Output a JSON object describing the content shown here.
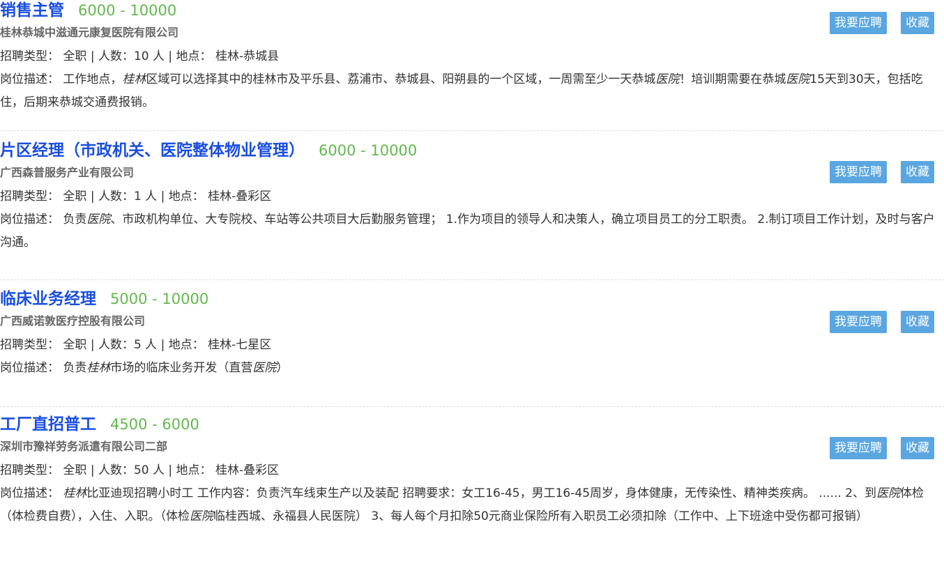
{
  "labels": {
    "type_prefix": "招聘类型：",
    "count_prefix": "人数：",
    "location_prefix": "地点：",
    "desc_prefix": "岗位描述：",
    "sep": "|"
  },
  "jobs": [
    {
      "title": "销售主管",
      "salary": "6000 - 10000",
      "company": "桂林恭城中滋通元康复医院有限公司",
      "type": "全职",
      "count": "10 人",
      "location": "桂林-恭城县",
      "apply_label": "我要应聘",
      "save_label": "收藏",
      "desc_parts": [
        {
          "t": "工作地点，",
          "em": false
        },
        {
          "t": "桂林",
          "em": true
        },
        {
          "t": "区域可以选择其中的桂林市及平乐县、荔浦市、恭城县、阳朔县的一个区域，一周需至少一天恭城",
          "em": false
        },
        {
          "t": "医院",
          "em": true
        },
        {
          "t": "！培训期需要在恭城",
          "em": false
        },
        {
          "t": "医院",
          "em": true
        },
        {
          "t": "15天到30天，包括吃住，后期来恭城交通费报销。",
          "em": false
        }
      ]
    },
    {
      "title": "片区经理（市政机关、医院整体物业管理）",
      "salary": "6000 - 10000",
      "company": "广西森普服务产业有限公司",
      "type": "全职",
      "count": "1 人",
      "location": "桂林-叠彩区",
      "apply_label": "我要应聘",
      "save_label": "收藏",
      "desc_parts": [
        {
          "t": "负责",
          "em": false
        },
        {
          "t": "医院",
          "em": true
        },
        {
          "t": "、市政机构单位、大专院校、车站等公共项目大后勤服务管理； 1.作为项目的领导人和决策人，确立项目员工的分工职责。 2.制订项目工作计划，及时与客户沟通。",
          "em": false
        }
      ]
    },
    {
      "title": "临床业务经理",
      "salary": "5000 - 10000",
      "company": "广西威诺敦医疗控股有限公司",
      "type": "全职",
      "count": "5 人",
      "location": "桂林-七星区",
      "apply_label": "我要应聘",
      "save_label": "收藏",
      "desc_parts": [
        {
          "t": "负责",
          "em": false
        },
        {
          "t": "桂林",
          "em": true
        },
        {
          "t": "市场的临床业务开发（直营",
          "em": false
        },
        {
          "t": "医院",
          "em": true
        },
        {
          "t": "）",
          "em": false
        }
      ]
    },
    {
      "title": "工厂直招普工",
      "salary": "4500 - 6000",
      "company": "深圳市豫祥劳务派遣有限公司二部",
      "type": "全职",
      "count": "50 人",
      "location": "桂林-叠彩区",
      "apply_label": "我要应聘",
      "save_label": "收藏",
      "desc_parts": [
        {
          "t": "桂林",
          "em": true
        },
        {
          "t": "比亚迪现招聘小时工 工作内容：负责汽车线束生产以及装配 招聘要求：女工16-45，男工16-45周岁，身体健康，无传染性、精神类疾病。 ...... 2、到",
          "em": false
        },
        {
          "t": "医院",
          "em": true
        },
        {
          "t": "体检（体检费自费），入住、入职。（体检",
          "em": false
        },
        {
          "t": "医院",
          "em": true
        },
        {
          "t": "临桂西城、永福县人民医院） 3、每人每个月扣除50元商业保险所有入职员工必须扣除（工作中、上下班途中受伤都可报销）",
          "em": false
        }
      ]
    }
  ]
}
